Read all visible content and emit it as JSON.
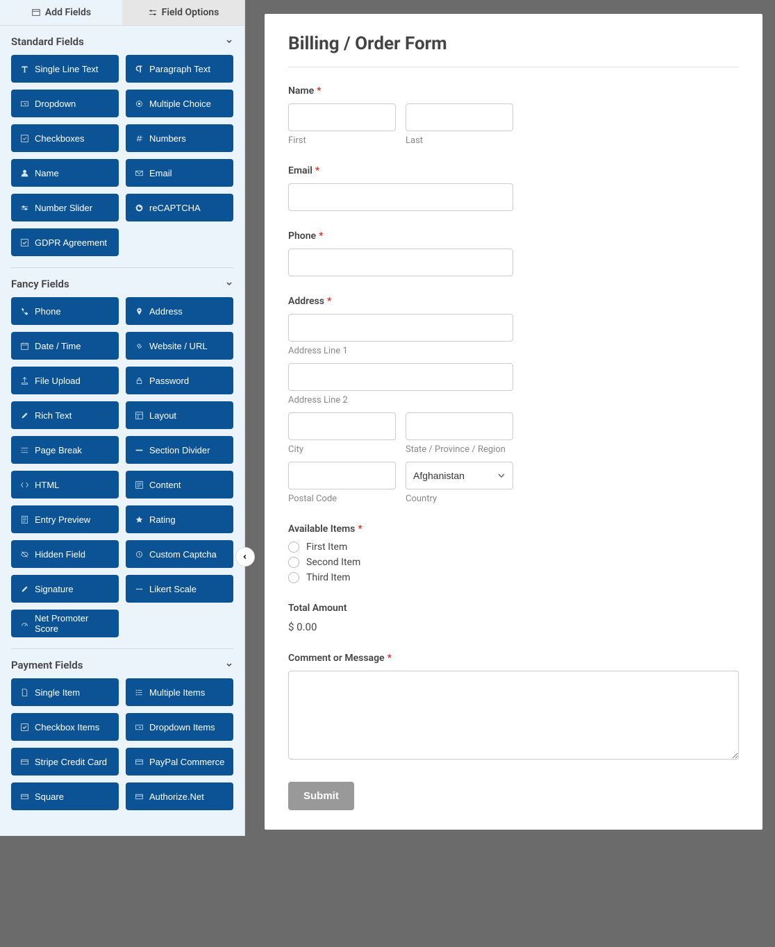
{
  "tabs": {
    "add_fields": "Add Fields",
    "field_options": "Field Options"
  },
  "sections": {
    "standard": {
      "title": "Standard Fields",
      "items": [
        {
          "name": "single-line-text",
          "label": "Single Line Text",
          "icon": "text"
        },
        {
          "name": "paragraph-text",
          "label": "Paragraph Text",
          "icon": "paragraph"
        },
        {
          "name": "dropdown",
          "label": "Dropdown",
          "icon": "dropdown"
        },
        {
          "name": "multiple-choice",
          "label": "Multiple Choice",
          "icon": "radio"
        },
        {
          "name": "checkboxes",
          "label": "Checkboxes",
          "icon": "checkbox"
        },
        {
          "name": "numbers",
          "label": "Numbers",
          "icon": "hash"
        },
        {
          "name": "name",
          "label": "Name",
          "icon": "user"
        },
        {
          "name": "email",
          "label": "Email",
          "icon": "mail"
        },
        {
          "name": "number-slider",
          "label": "Number Slider",
          "icon": "slider"
        },
        {
          "name": "recaptcha",
          "label": "reCAPTCHA",
          "icon": "google"
        },
        {
          "name": "gdpr",
          "label": "GDPR Agreement",
          "icon": "check"
        }
      ]
    },
    "fancy": {
      "title": "Fancy Fields",
      "items": [
        {
          "name": "phone",
          "label": "Phone",
          "icon": "phone"
        },
        {
          "name": "address",
          "label": "Address",
          "icon": "pin"
        },
        {
          "name": "date-time",
          "label": "Date / Time",
          "icon": "calendar"
        },
        {
          "name": "website-url",
          "label": "Website / URL",
          "icon": "link"
        },
        {
          "name": "file-upload",
          "label": "File Upload",
          "icon": "upload"
        },
        {
          "name": "password",
          "label": "Password",
          "icon": "lock"
        },
        {
          "name": "rich-text",
          "label": "Rich Text",
          "icon": "pencil"
        },
        {
          "name": "layout",
          "label": "Layout",
          "icon": "layout"
        },
        {
          "name": "page-break",
          "label": "Page Break",
          "icon": "pagebreak"
        },
        {
          "name": "section-divider",
          "label": "Section Divider",
          "icon": "divider"
        },
        {
          "name": "html",
          "label": "HTML",
          "icon": "code"
        },
        {
          "name": "content",
          "label": "Content",
          "icon": "content"
        },
        {
          "name": "entry-preview",
          "label": "Entry Preview",
          "icon": "preview"
        },
        {
          "name": "rating",
          "label": "Rating",
          "icon": "star"
        },
        {
          "name": "hidden-field",
          "label": "Hidden Field",
          "icon": "hidden"
        },
        {
          "name": "custom-captcha",
          "label": "Custom Captcha",
          "icon": "captcha"
        },
        {
          "name": "signature",
          "label": "Signature",
          "icon": "pencil"
        },
        {
          "name": "likert-scale",
          "label": "Likert Scale",
          "icon": "likert"
        },
        {
          "name": "net-promoter",
          "label": "Net Promoter Score",
          "icon": "nps"
        }
      ]
    },
    "payment": {
      "title": "Payment Fields",
      "items": [
        {
          "name": "single-item",
          "label": "Single Item",
          "icon": "file"
        },
        {
          "name": "multiple-items",
          "label": "Multiple Items",
          "icon": "list"
        },
        {
          "name": "checkbox-items",
          "label": "Checkbox Items",
          "icon": "check"
        },
        {
          "name": "dropdown-items",
          "label": "Dropdown Items",
          "icon": "dropdown"
        },
        {
          "name": "stripe",
          "label": "Stripe Credit Card",
          "icon": "card"
        },
        {
          "name": "paypal",
          "label": "PayPal Commerce",
          "icon": "card"
        },
        {
          "name": "square",
          "label": "Square",
          "icon": "card"
        },
        {
          "name": "authorize",
          "label": "Authorize.Net",
          "icon": "card"
        }
      ]
    }
  },
  "form": {
    "title": "Billing / Order Form",
    "name_label": "Name",
    "first_sub": "First",
    "last_sub": "Last",
    "email_label": "Email",
    "phone_label": "Phone",
    "address_label": "Address",
    "addr1_sub": "Address Line 1",
    "addr2_sub": "Address Line 2",
    "city_sub": "City",
    "state_sub": "State / Province / Region",
    "postal_sub": "Postal Code",
    "country_sub": "Country",
    "country_selected": "Afghanistan",
    "items_label": "Available Items",
    "items": [
      "First Item",
      "Second Item",
      "Third Item"
    ],
    "total_label": "Total Amount",
    "total_value": "$ 0.00",
    "comment_label": "Comment or Message",
    "submit": "Submit"
  }
}
